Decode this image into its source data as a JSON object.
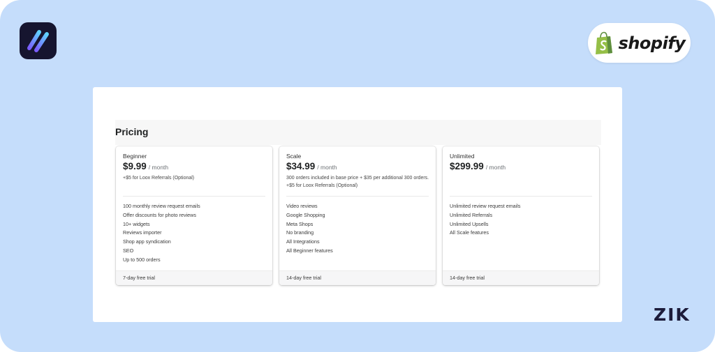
{
  "branding": {
    "shopify_text": "shopify",
    "corner_mark": "ZIK",
    "shopify_green": "#95bf47",
    "app_logo_bg": "#16152f"
  },
  "pricing": {
    "title": "Pricing",
    "plans": [
      {
        "name": "Beginner",
        "price": "$9.99",
        "period": "/ month",
        "note": "+$5 for Loox Referrals (Optional)",
        "features": [
          "100 monthly review request emails",
          "Offer discounts for photo reviews",
          "10+ widgets",
          "Reviews importer",
          "Shop app syndication",
          "SEO",
          "Up to 500 orders"
        ],
        "trial": "7-day free trial"
      },
      {
        "name": "Scale",
        "price": "$34.99",
        "period": "/ month",
        "note": "300 orders included in base price + $35 per additional 300 orders. +$5 for Loox Referrals (Optional)",
        "features": [
          "Video reviews",
          "Google Shopping",
          "Meta Shops",
          "No branding",
          "All Integrations",
          "All Beginner features"
        ],
        "trial": "14-day free trial"
      },
      {
        "name": "Unlimited",
        "price": "$299.99",
        "period": "/ month",
        "note": "",
        "features": [
          "Unlimited review request emails",
          "Unlimited Referrals",
          "Unlimited Upsells",
          "All Scale features"
        ],
        "trial": "14-day free trial"
      }
    ]
  }
}
